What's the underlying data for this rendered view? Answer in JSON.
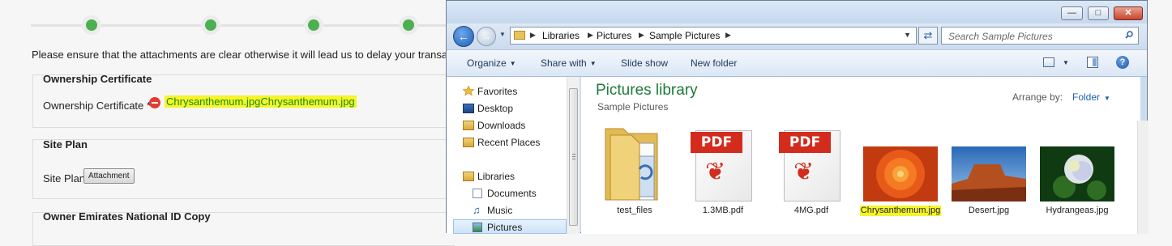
{
  "form": {
    "notice": "Please ensure that the attachments are clear otherwise it will lead us to delay your transactio",
    "sections": {
      "ownership": {
        "title": "Ownership Certificate",
        "label": "Ownership Certificate *",
        "files": "Chrysanthemum.jpgChrysanthemum.jpg"
      },
      "site_plan": {
        "title": "Site Plan",
        "label": "Site Plan",
        "button": "Attachment"
      },
      "owner_id": {
        "title": "Owner Emirates National ID Copy"
      }
    }
  },
  "explorer": {
    "breadcrumb": [
      "Libraries",
      "Pictures",
      "Sample Pictures"
    ],
    "search_placeholder": "Search Sample Pictures",
    "toolbar": {
      "organize": "Organize",
      "share_with": "Share with",
      "slide_show": "Slide show",
      "new_folder": "New folder"
    },
    "nav": {
      "favorites": "Favorites",
      "desktop": "Desktop",
      "downloads": "Downloads",
      "recent_places": "Recent Places",
      "libraries": "Libraries",
      "documents": "Documents",
      "music": "Music",
      "pictures": "Pictures"
    },
    "library_title": "Pictures library",
    "library_subtitle": "Sample Pictures",
    "arrange_by_label": "Arrange by:",
    "arrange_by_value": "Folder",
    "files": [
      {
        "name": "test_files",
        "icon": "folder-icon"
      },
      {
        "name": "1.3MB.pdf",
        "icon": "pdf-icon",
        "badge": "PDF"
      },
      {
        "name": "4MG.pdf",
        "icon": "pdf-icon",
        "badge": "PDF"
      },
      {
        "name": "Chrysanthemum.jpg",
        "icon": "image-thumbnail",
        "selected": true
      },
      {
        "name": "Desert.jpg",
        "icon": "image-thumbnail"
      },
      {
        "name": "Hydrangeas.jpg",
        "icon": "image-thumbnail"
      }
    ],
    "highlight_color": "#f5f52a",
    "library_title_color": "#1e7a3a",
    "close_button_color": "#c8452c"
  }
}
